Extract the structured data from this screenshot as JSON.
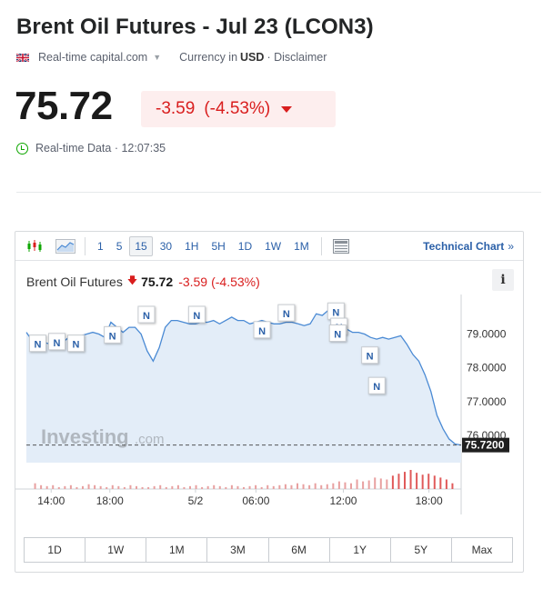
{
  "header": {
    "title": "Brent Oil Futures - Jul 23 (LCON3)",
    "source": "Real-time capital.com",
    "currency_prefix": "Currency in",
    "currency": "USD",
    "disclaimer": "· Disclaimer"
  },
  "quote": {
    "price": "75.72",
    "change": "-3.59",
    "change_pct": "(-4.53%)",
    "realtime_label": "Real-time Data · 12:07:35"
  },
  "toolbar": {
    "timeframes": [
      "1",
      "5",
      "15",
      "30",
      "1H",
      "5H",
      "1D",
      "1W",
      "1M"
    ],
    "active_timeframe": "15",
    "technical_chart": "Technical Chart",
    "technical_chev": "»"
  },
  "legend": {
    "name": "Brent Oil Futures",
    "price": "75.72",
    "change": "-3.59",
    "change_pct": "(-4.53%)"
  },
  "info_label": "i",
  "watermark": {
    "brand": "Investing",
    "suffix": ".com"
  },
  "news_marker": "N",
  "ranges": [
    "1D",
    "1W",
    "1M",
    "3M",
    "6M",
    "1Y",
    "5Y",
    "Max"
  ],
  "colors": {
    "negative": "#d91e1e",
    "line": "#4a8ad4",
    "area": "#e3edf8",
    "realtime_icon": "#0ea600"
  },
  "chart_data": {
    "type": "area",
    "x_tick_labels": [
      "14:00",
      "18:00",
      "5/2",
      "06:00",
      "12:00",
      "18:00"
    ],
    "y_tick_labels": [
      "79.0000",
      "78.0000",
      "77.0000",
      "76.0000"
    ],
    "ylim": [
      75.2,
      79.9
    ],
    "last_price_label": "75.7200",
    "last_price": 75.72,
    "series": [
      {
        "values": [
          79.05,
          78.8,
          78.7,
          78.75,
          78.7,
          78.8,
          78.75,
          78.9,
          78.8,
          78.95,
          79.0,
          79.05,
          79.0,
          78.9,
          79.35,
          79.2,
          79.05,
          79.2,
          79.2,
          79.0,
          78.5,
          78.2,
          78.6,
          79.2,
          79.4,
          79.4,
          79.35,
          79.3,
          79.3,
          79.35,
          79.35,
          79.4,
          79.3,
          79.4,
          79.5,
          79.4,
          79.4,
          79.3,
          79.35,
          79.4,
          79.35,
          79.3,
          79.3,
          79.35,
          79.35,
          79.3,
          79.25,
          79.3,
          79.6,
          79.55,
          79.7,
          79.5,
          79.3,
          79.15,
          79.05,
          79.05,
          79.0,
          78.9,
          78.85,
          78.9,
          78.85,
          78.9,
          78.95,
          78.7,
          78.4,
          78.2,
          77.8,
          77.3,
          76.6,
          76.2,
          75.9,
          75.75,
          75.72
        ]
      }
    ],
    "volume": [
      0.3,
      0.2,
      0.15,
      0.2,
      0.1,
      0.15,
      0.2,
      0.1,
      0.15,
      0.25,
      0.2,
      0.15,
      0.1,
      0.2,
      0.15,
      0.1,
      0.2,
      0.15,
      0.1,
      0.1,
      0.15,
      0.2,
      0.1,
      0.15,
      0.2,
      0.1,
      0.15,
      0.2,
      0.1,
      0.15,
      0.2,
      0.15,
      0.1,
      0.2,
      0.15,
      0.1,
      0.15,
      0.2,
      0.1,
      0.2,
      0.15,
      0.2,
      0.25,
      0.2,
      0.3,
      0.25,
      0.2,
      0.3,
      0.2,
      0.25,
      0.3,
      0.4,
      0.35,
      0.3,
      0.5,
      0.4,
      0.45,
      0.6,
      0.55,
      0.5,
      0.7,
      0.8,
      0.9,
      1.0,
      0.85,
      0.75,
      0.8,
      0.7,
      0.6,
      0.5,
      0.3
    ],
    "news_markers": [
      {
        "x": 0.026,
        "y": 78.7
      },
      {
        "x": 0.07,
        "y": 78.75
      },
      {
        "x": 0.114,
        "y": 78.7
      },
      {
        "x": 0.198,
        "y": 78.95
      },
      {
        "x": 0.276,
        "y": 79.55
      },
      {
        "x": 0.392,
        "y": 79.55
      },
      {
        "x": 0.542,
        "y": 79.1
      },
      {
        "x": 0.598,
        "y": 79.6
      },
      {
        "x": 0.712,
        "y": 79.65
      },
      {
        "x": 0.719,
        "y": 79.2
      },
      {
        "x": 0.716,
        "y": 79.0
      },
      {
        "x": 0.79,
        "y": 78.35
      },
      {
        "x": 0.806,
        "y": 77.45
      }
    ]
  }
}
